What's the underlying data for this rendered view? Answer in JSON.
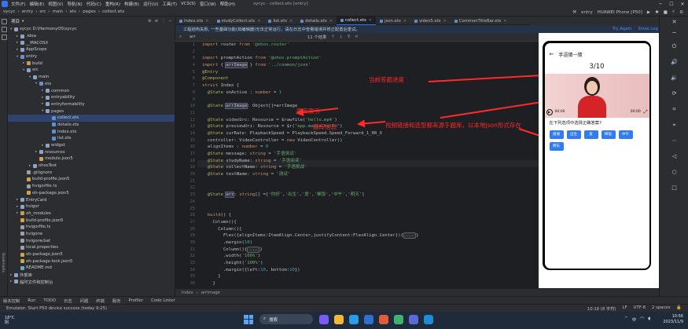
{
  "window": {
    "menus": [
      "文件(F)",
      "编辑(E)",
      "视图(V)",
      "导航(N)",
      "代码(C)",
      "重构(R)",
      "构建(B)",
      "运行(U)",
      "工具(T)",
      "VCS(S)",
      "窗口(W)",
      "帮助(H)"
    ],
    "title": "sycyc - collect.ets [entry]"
  },
  "navbar": {
    "crumbs": [
      "sycyc",
      "entry",
      "src",
      "main",
      "ets",
      "pages",
      "collect.ets"
    ],
    "module": "entry",
    "device": "HUAWEI Phone [P50]"
  },
  "project": {
    "header": "项目",
    "tree": [
      {
        "label": "sycyc  D:\\HarmonyOS\\sycyc",
        "depth": 0,
        "open": true,
        "icon": "fold"
      },
      {
        "label": ".idea",
        "depth": 1,
        "open": false,
        "icon": "fold"
      },
      {
        "label": "__MACOSX",
        "depth": 1,
        "open": false,
        "icon": "fold"
      },
      {
        "label": "AppScope",
        "depth": 1,
        "open": false,
        "icon": "fold"
      },
      {
        "label": "entry",
        "depth": 1,
        "open": true,
        "icon": "fold src"
      },
      {
        "label": "build",
        "depth": 2,
        "open": false,
        "icon": "fold excl"
      },
      {
        "label": "src",
        "depth": 2,
        "open": true,
        "icon": "fold"
      },
      {
        "label": "main",
        "depth": 3,
        "open": true,
        "icon": "fold"
      },
      {
        "label": "ets",
        "depth": 4,
        "open": true,
        "icon": "fold src"
      },
      {
        "label": "common",
        "depth": 5,
        "open": false,
        "icon": "fold"
      },
      {
        "label": "entryability",
        "depth": 5,
        "open": false,
        "icon": "fold"
      },
      {
        "label": "entryformability",
        "depth": 5,
        "open": false,
        "icon": "fold"
      },
      {
        "label": "pages",
        "depth": 5,
        "open": true,
        "icon": "fold"
      },
      {
        "label": "collect.ets",
        "depth": 6,
        "icon": "file ets",
        "selected": true
      },
      {
        "label": "details.ets",
        "depth": 6,
        "icon": "file ets"
      },
      {
        "label": "Index.ets",
        "depth": 6,
        "icon": "file ets"
      },
      {
        "label": "list.ets",
        "depth": 6,
        "icon": "file ets"
      },
      {
        "label": "widget",
        "depth": 5,
        "open": false,
        "icon": "fold"
      },
      {
        "label": "resources",
        "depth": 4,
        "open": false,
        "icon": "fold"
      },
      {
        "label": "module.json5",
        "depth": 4,
        "icon": "file json"
      },
      {
        "label": "ohosTest",
        "depth": 3,
        "open": false,
        "icon": "fold"
      },
      {
        "label": ".gitignore",
        "depth": 2,
        "icon": "file"
      },
      {
        "label": "build-profile.json5",
        "depth": 2,
        "icon": "file json"
      },
      {
        "label": "hvigorfile.ts",
        "depth": 2,
        "icon": "file"
      },
      {
        "label": "oh-package.json5",
        "depth": 2,
        "icon": "file json"
      },
      {
        "label": "EntryCard",
        "depth": 1,
        "open": false,
        "icon": "fold"
      },
      {
        "label": "hvigor",
        "depth": 1,
        "open": false,
        "icon": "fold"
      },
      {
        "label": "oh_modules",
        "depth": 1,
        "open": false,
        "icon": "fold excl"
      },
      {
        "label": "build-profile.json5",
        "depth": 1,
        "icon": "file json"
      },
      {
        "label": "hvigorfile.ts",
        "depth": 1,
        "icon": "file"
      },
      {
        "label": "hvigorw",
        "depth": 1,
        "icon": "file"
      },
      {
        "label": "hvigorw.bat",
        "depth": 1,
        "icon": "file"
      },
      {
        "label": "local.properties",
        "depth": 1,
        "icon": "file"
      },
      {
        "label": "oh-package.json5",
        "depth": 1,
        "icon": "file json"
      },
      {
        "label": "oh-package-lock.json5",
        "depth": 1,
        "icon": "file json"
      },
      {
        "label": "README.md",
        "depth": 1,
        "icon": "file md"
      },
      {
        "label": "外部库",
        "depth": 0,
        "open": false,
        "icon": "fold"
      },
      {
        "label": "临时文件和控制台",
        "depth": 0,
        "open": false,
        "icon": "fold"
      }
    ]
  },
  "tabs": [
    {
      "label": "Index.ets",
      "active": false
    },
    {
      "label": "studyCollect.ets",
      "active": false
    },
    {
      "label": "list.ets",
      "active": false
    },
    {
      "label": "details.ets",
      "active": false
    },
    {
      "label": "collect.ets",
      "active": true
    },
    {
      "label": "json.ets",
      "active": false
    },
    {
      "label": "video5.ets",
      "active": false
    },
    {
      "label": "CommonTitleBar.ets",
      "active": false
    }
  ],
  "banner": {
    "text": "工程结构失败, 一些基础功能(如编辑器)无法正常运行。请在日志中查看错误并修正配置后重试。",
    "try_again": "Try Again",
    "show_log": "Show Log in Explorer"
  },
  "find": {
    "query": "arr",
    "result": "11 个结果"
  },
  "code_lines": [
    {
      "n": "1",
      "html": "<span class=\"kw\">import</span> router <span class=\"kw\">from</span> <span class=\"st\">'@ohos.router'</span>"
    },
    {
      "n": "2",
      "html": ""
    },
    {
      "n": "3",
      "html": "<span class=\"kw\">import</span> promptAction <span class=\"kw\">from</span> <span class=\"st\">'@ohos.promptAction'</span>"
    },
    {
      "n": "4",
      "html": "<span class=\"kw\">import</span> { <span class=\"hl\">arrImage</span> } <span class=\"kw\">from</span> <span class=\"st\">'../common/json'</span>"
    },
    {
      "n": "5",
      "html": "<span class=\"an\">@Entry</span>"
    },
    {
      "n": "6",
      "html": "<span class=\"an\">@Component</span>"
    },
    {
      "n": "7",
      "html": "<span class=\"kw\">struct</span> Index {"
    },
    {
      "n": "8",
      "html": "  <span class=\"an\">@State</span> onActive : <span class=\"kw\">number</span> = <span class=\"num\">1</span>"
    },
    {
      "n": "9",
      "html": ""
    },
    {
      "n": "10",
      "html": "  <span class=\"an\">@State</span> <span class=\"hl\">arrImage</span>: Object[]=arrImage"
    },
    {
      "n": "11",
      "html": ""
    },
    {
      "n": "12",
      "html": "  <span class=\"an\">@State</span> videoSrc: Resource = $rawfile(<span class=\"st\">'hello.mp4'</span>)"
    },
    {
      "n": "13",
      "html": "  <span class=\"an\">@State</span> previewUri: Resource = $r(<span class=\"st\">\"app.media.hello\"</span>)"
    },
    {
      "n": "14",
      "html": "  <span class=\"an\">@State</span> curRate: PlaybackSpeed = PlaybackSpeed.Speed_Forward_1_00_X"
    },
    {
      "n": "15",
      "html": "  controller: VideoController = <span class=\"kw\">new</span> VideoController()"
    },
    {
      "n": "16",
      "html": "  alignItems : <span class=\"kw\">number</span> = <span class=\"num\">0</span>"
    },
    {
      "n": "17",
      "html": "  <span class=\"an\">@State</span> message: <span class=\"kw\">string</span> = <span class=\"st\">'手语测试'</span>"
    },
    {
      "n": "18",
      "html": "  <span class=\"an\">@State</span> studyName: <span class=\"kw\">string</span> = <span class=\"st\">'手语阅读'</span>"
    },
    {
      "n": "19",
      "html": "  <span class=\"an\">@State</span> collectName: <span class=\"kw\">string</span> = <span class=\"st\">'手语挑战'</span>"
    },
    {
      "n": "20",
      "html": "  <span class=\"an\">@State</span> testName: <span class=\"kw\">string</span> = <span class=\"st\">'测试'</span>"
    },
    {
      "n": "21",
      "html": ""
    },
    {
      "n": "22",
      "html": ""
    },
    {
      "n": "23",
      "html": "  <span class=\"an\">@State</span> <span class=\"hl\">arr</span>: <span class=\"kw\">string</span>[] =[<span class=\"st\">'你好'</span>,<span class=\"st\">'出生'</span>,<span class=\"st\">'爱'</span>,<span class=\"st\">'稀饭'</span>,<span class=\"st\">'中午'</span>,<span class=\"st\">'明天'</span>]"
    },
    {
      "n": "24",
      "html": ""
    },
    {
      "n": "25",
      "html": ""
    },
    {
      "n": "26",
      "html": "  <span class=\"kw\">build</span>() {"
    },
    {
      "n": "27",
      "html": "    Column(){"
    },
    {
      "n": "28",
      "html": "      Column(){"
    },
    {
      "n": "29",
      "html": "        Flex({alignItems:ItemAlign.Center,justifyContent:FlexAlign.Center}){<span class=\"fold-btn\">...</span>}"
    },
    {
      "n": "30",
      "html": "        .margin(<span class=\"num\">10</span>)"
    },
    {
      "n": "31",
      "html": "        Column(){<span class=\"fold-btn\">...</span>}"
    },
    {
      "n": "32",
      "html": "        .width(<span class=\"st\">'100%'</span>)"
    },
    {
      "n": "33",
      "html": "        .height(<span class=\"st\">'100%'</span>)"
    },
    {
      "n": "34",
      "html": "        .margin({left:<span class=\"num\">10</span>, bottom:<span class=\"num\">10</span>})"
    },
    {
      "n": "35",
      "html": "      }"
    },
    {
      "n": "36",
      "html": "    }"
    }
  ],
  "annotations": {
    "progress": "当前答题进度",
    "index": "题库索引",
    "bank": "题库信息",
    "source": "视频链接和选型都来源于题库，以本地json形式存在"
  },
  "preview": {
    "title": "手语猜一猜",
    "progress": "3/10",
    "time_start": "00:00",
    "time_end": "00:00",
    "question": "在下列选项中选择正确答案?",
    "options": [
      "谢谢",
      "出生",
      "爱",
      "稀饭",
      "中午",
      "明天"
    ]
  },
  "crumb_bottom": [
    "Index",
    "arrImage"
  ],
  "toolwindows": [
    "版本控制",
    "Run",
    "TODO",
    "日志",
    "问题",
    "终端",
    "服务",
    "Profiler",
    "Code Linter"
  ],
  "status": {
    "message": "Emulator: Start P50 device success (today 9:25)",
    "position": "10:18 (8 字符)",
    "eol": "LF",
    "encoding": "UTF-8",
    "indent": "2 spaces"
  },
  "taskbar": {
    "weather_temp": "18°C",
    "weather_desc": "阴",
    "search": "搜索",
    "time": "10:56",
    "date": "2023/11/9",
    "lang": "中"
  },
  "colors": {
    "accent": "#3574f0",
    "annotation": "#ff2a2a",
    "option_button": "#2f7cf6"
  }
}
